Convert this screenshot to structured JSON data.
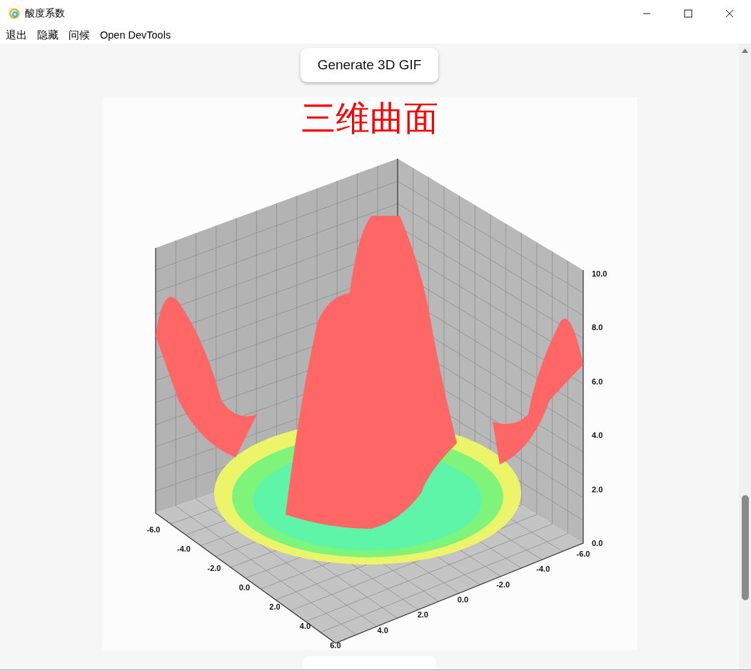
{
  "window": {
    "title": "酸度系数"
  },
  "menu": [
    "退出",
    "隐藏",
    "问候",
    "Open DevTools"
  ],
  "buttons": [
    {
      "label": "Generate 3D GIF"
    }
  ],
  "plot": {
    "title": "三维曲面",
    "x_ticks": [
      "-6.0",
      "-4.0",
      "-2.0",
      "0.0",
      "2.0",
      "4.0",
      "6.0"
    ],
    "y_ticks": [
      "4.0",
      "2.0",
      "0.0",
      "-2.0",
      "-4.0",
      "-6.0"
    ],
    "z_ticks": [
      "10.0",
      "8.0",
      "6.0",
      "4.0",
      "2.0",
      "0.0"
    ]
  }
}
